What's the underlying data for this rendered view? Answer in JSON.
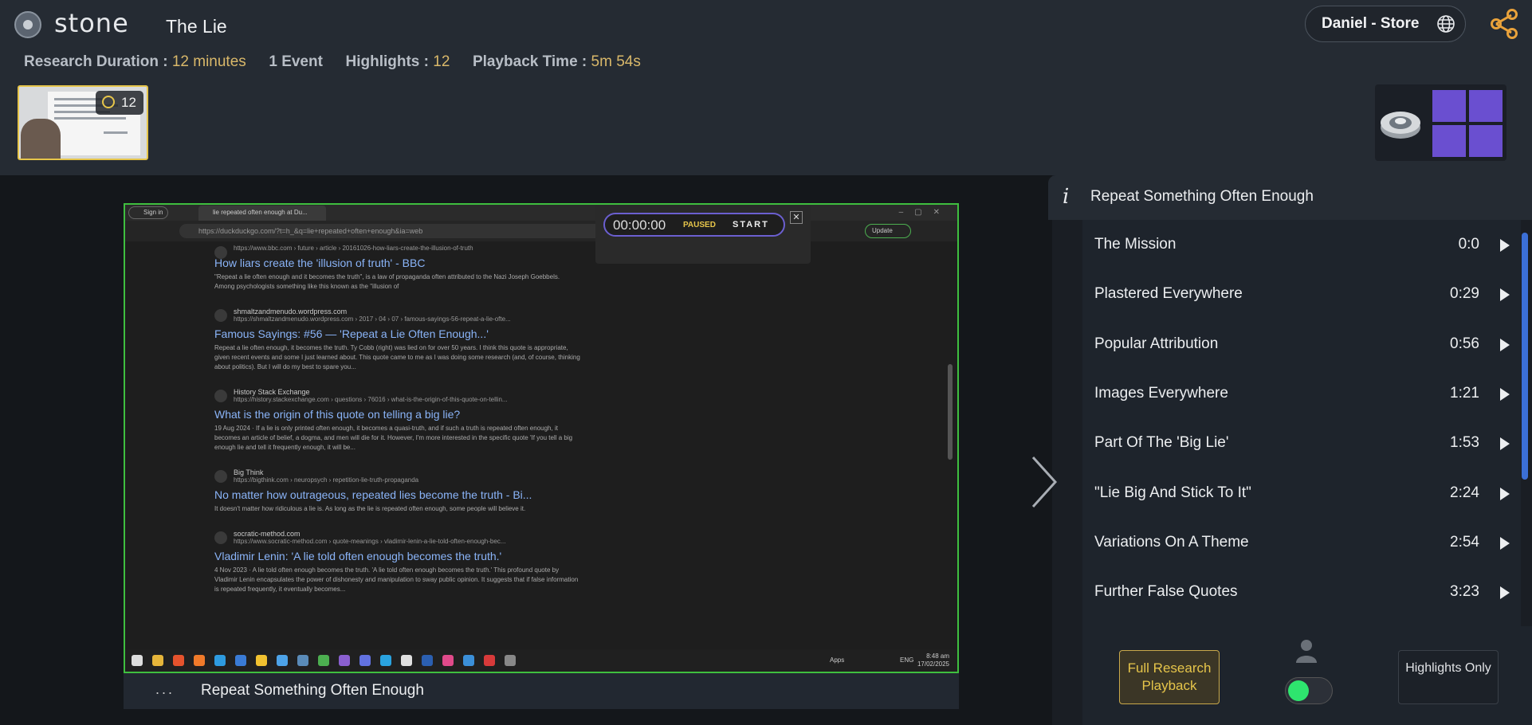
{
  "app": {
    "logo": "stone",
    "title": "The Lie"
  },
  "stats": {
    "duration_label": "Research Duration :",
    "duration_value": "12 minutes",
    "events": "1 Event",
    "highlights_label": "Highlights :",
    "highlights_value": "12",
    "playback_label": "Playback Time :",
    "playback_value": "5m 54s"
  },
  "user": {
    "name": "Daniel - Store"
  },
  "thumbnail": {
    "count": "12"
  },
  "screenshot": {
    "browser": {
      "signin": "Sign in",
      "tab_title": "lie repeated often enough at Du...",
      "url": "https://duckduckgo.com/?t=h_&q=lie+repeated+often+enough&ia=web",
      "update_label": "Update"
    },
    "recorder": {
      "time": "00:00:00",
      "status": "PAUSED",
      "start": "START"
    },
    "results": [
      {
        "site": "",
        "url": "https://www.bbc.com › future › article › 20161026-how-liars-create-the-illusion-of-truth",
        "title": "How liars create the 'illusion of truth' - BBC",
        "snippet": "\"Repeat a lie often enough and it becomes the truth\", is a law of propaganda often attributed to the Nazi Joseph Goebbels. Among psychologists something like this known as the \"illusion of"
      },
      {
        "site": "shmaltzandmenudo.wordpress.com",
        "url": "https://shmaltzandmenudo.wordpress.com › 2017 › 04 › 07 › famous-sayings-56-repeat-a-lie-ofte...",
        "title": "Famous Sayings: #56 — 'Repeat a Lie Often Enough...'",
        "snippet": "Repeat a lie often enough, it becomes the truth. Ty Cobb (right) was lied on for over 50 years. I think this quote is appropriate, given recent events and some I just learned about. This quote came to me as I was doing some research (and, of course, thinking about politics). But I will do my best to spare you..."
      },
      {
        "site": "History Stack Exchange",
        "url": "https://history.stackexchange.com › questions › 76016 › what-is-the-origin-of-this-quote-on-tellin...",
        "title": "What is the origin of this quote on telling a big lie?",
        "snippet": "19 Aug 2024 · If a lie is only printed often enough, it becomes a quasi-truth, and if such a truth is repeated often enough, it becomes an article of belief, a dogma, and men will die for it. However, I'm more interested in the specific quote 'If you tell a big enough lie and tell it frequently enough, it will be..."
      },
      {
        "site": "Big Think",
        "url": "https://bigthink.com › neuropsych › repetition-lie-truth-propaganda",
        "title": "No matter how outrageous, repeated lies become the truth - Bi...",
        "snippet": "It doesn't matter how ridiculous a lie is. As long as the lie is repeated often enough, some people will believe it."
      },
      {
        "site": "socratic-method.com",
        "url": "https://www.socratic-method.com › quote-meanings › vladimir-lenin-a-lie-told-often-enough-bec...",
        "title": "Vladimir Lenin: 'A lie told often enough becomes the truth.'",
        "snippet": "4 Nov 2023 · A lie told often enough becomes the truth. 'A lie told often enough becomes the truth.' This profound quote by Vladimir Lenin encapsulates the power of dishonesty and manipulation to sway public opinion. It suggests that if false information is repeated frequently, it eventually becomes..."
      }
    ],
    "taskbar": {
      "clock_time": "8:48 am",
      "clock_date": "17/02/2025",
      "lang": "ENG",
      "apps_label": "Apps"
    }
  },
  "caption": {
    "dots": "...",
    "text": "Repeat Something Often Enough"
  },
  "panel": {
    "title": "Repeat Something Often Enough",
    "chapters": [
      {
        "name": "The Mission",
        "time": "0:0"
      },
      {
        "name": "Plastered Everywhere",
        "time": "0:29"
      },
      {
        "name": "Popular Attribution",
        "time": "0:56"
      },
      {
        "name": "Images Everywhere",
        "time": "1:21"
      },
      {
        "name": "Part Of The 'Big Lie'",
        "time": "1:53"
      },
      {
        "name": "\"Lie Big And Stick To It\"",
        "time": "2:24"
      },
      {
        "name": "Variations On A Theme",
        "time": "2:54"
      },
      {
        "name": "Further False Quotes",
        "time": "3:23"
      }
    ],
    "full_playback_label": "Full Research Playback",
    "highlights_only_label": "Highlights Only",
    "toggle_on": true
  },
  "colors": {
    "accent_gold": "#d9b86a",
    "toggle_green": "#2ee56e",
    "grid_purple": "#6a4fd0",
    "frame_green": "#3fbf3f"
  }
}
